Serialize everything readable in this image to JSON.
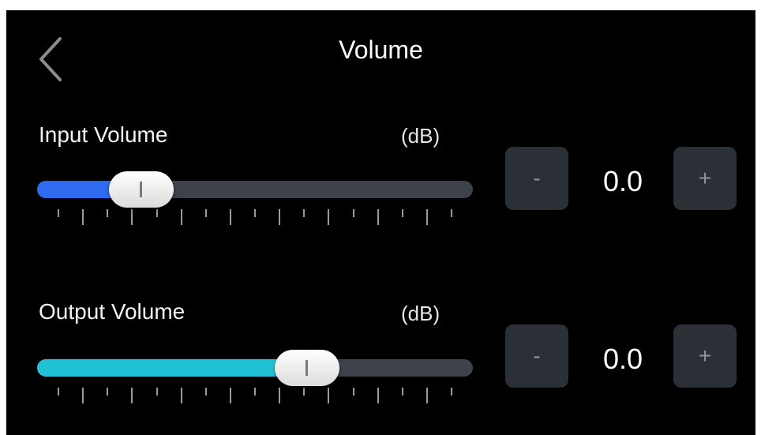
{
  "header": {
    "title": "Volume",
    "back_icon": "chevron-left-icon"
  },
  "colors": {
    "background": "#000000",
    "input_fill": "#2f6bf0",
    "output_fill": "#22c2d6",
    "track": "#3e434b",
    "stepper_bg": "#2b3036"
  },
  "input_volume": {
    "label": "Input Volume",
    "unit": "(dB)",
    "value": "0.0",
    "slider_fraction": 0.24,
    "decrement_label": "-",
    "increment_label": "+"
  },
  "output_volume": {
    "label": "Output Volume",
    "unit": "(dB)",
    "value": "0.0",
    "slider_fraction": 0.62,
    "decrement_label": "-",
    "increment_label": "+"
  }
}
